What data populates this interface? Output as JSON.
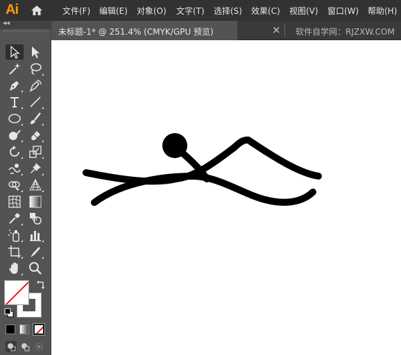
{
  "app": {
    "logo": "Ai"
  },
  "menu": [
    {
      "label": "文件(F)"
    },
    {
      "label": "编辑(E)"
    },
    {
      "label": "对象(O)"
    },
    {
      "label": "文字(T)"
    },
    {
      "label": "选择(S)"
    },
    {
      "label": "效果(C)"
    },
    {
      "label": "视图(V)"
    },
    {
      "label": "窗口(W)"
    },
    {
      "label": "帮助(H)"
    }
  ],
  "tabs": {
    "active": "未标题-1* @ 251.4% (CMYK/GPU 预览)",
    "close": "×",
    "inactive": "软件自学网：RJZXW.COM"
  },
  "toolbar": {
    "collapse": "◂◂",
    "tools": [
      {
        "name": "selection-tool",
        "icon": "selection-arrow-icon",
        "selected": true
      },
      {
        "name": "direct-selection-tool",
        "icon": "direct-selection-icon"
      },
      {
        "name": "magic-wand-tool",
        "icon": "magic-wand-icon"
      },
      {
        "name": "lasso-tool",
        "icon": "lasso-icon"
      },
      {
        "name": "pen-tool",
        "icon": "pen-icon"
      },
      {
        "name": "curvature-tool",
        "icon": "curvature-pen-icon"
      },
      {
        "name": "type-tool",
        "icon": "type-icon",
        "text": "T"
      },
      {
        "name": "line-segment-tool",
        "icon": "line-segment-icon"
      },
      {
        "name": "ellipse-tool",
        "icon": "ellipse-icon"
      },
      {
        "name": "paintbrush-tool",
        "icon": "paintbrush-icon"
      },
      {
        "name": "shaper-tool",
        "icon": "shaper-icon"
      },
      {
        "name": "eraser-tool",
        "icon": "eraser-icon"
      },
      {
        "name": "rotate-tool",
        "icon": "rotate-icon"
      },
      {
        "name": "scale-tool",
        "icon": "scale-icon"
      },
      {
        "name": "warp-tool",
        "icon": "warp-icon"
      },
      {
        "name": "puppet-warp-tool",
        "icon": "pushpin-icon"
      },
      {
        "name": "shape-builder-tool",
        "icon": "shape-builder-icon"
      },
      {
        "name": "perspective-grid-tool",
        "icon": "perspective-grid-icon"
      },
      {
        "name": "mesh-tool",
        "icon": "mesh-icon"
      },
      {
        "name": "gradient-tool",
        "icon": "gradient-icon"
      },
      {
        "name": "eyedropper-tool",
        "icon": "eyedropper-icon"
      },
      {
        "name": "blend-tool",
        "icon": "blend-icon"
      },
      {
        "name": "symbol-sprayer-tool",
        "icon": "symbol-sprayer-icon"
      },
      {
        "name": "column-graph-tool",
        "icon": "column-graph-icon"
      },
      {
        "name": "artboard-tool",
        "icon": "artboard-icon"
      },
      {
        "name": "slice-tool",
        "icon": "slice-icon"
      },
      {
        "name": "hand-tool",
        "icon": "hand-icon"
      },
      {
        "name": "zoom-tool",
        "icon": "zoom-icon"
      }
    ],
    "fill_color": "#ffffff",
    "stroke_color": "#ffffff",
    "none_indicator_color": "#e8141b"
  },
  "canvas": {
    "background": "#ffffff",
    "art_color": "#000000"
  }
}
